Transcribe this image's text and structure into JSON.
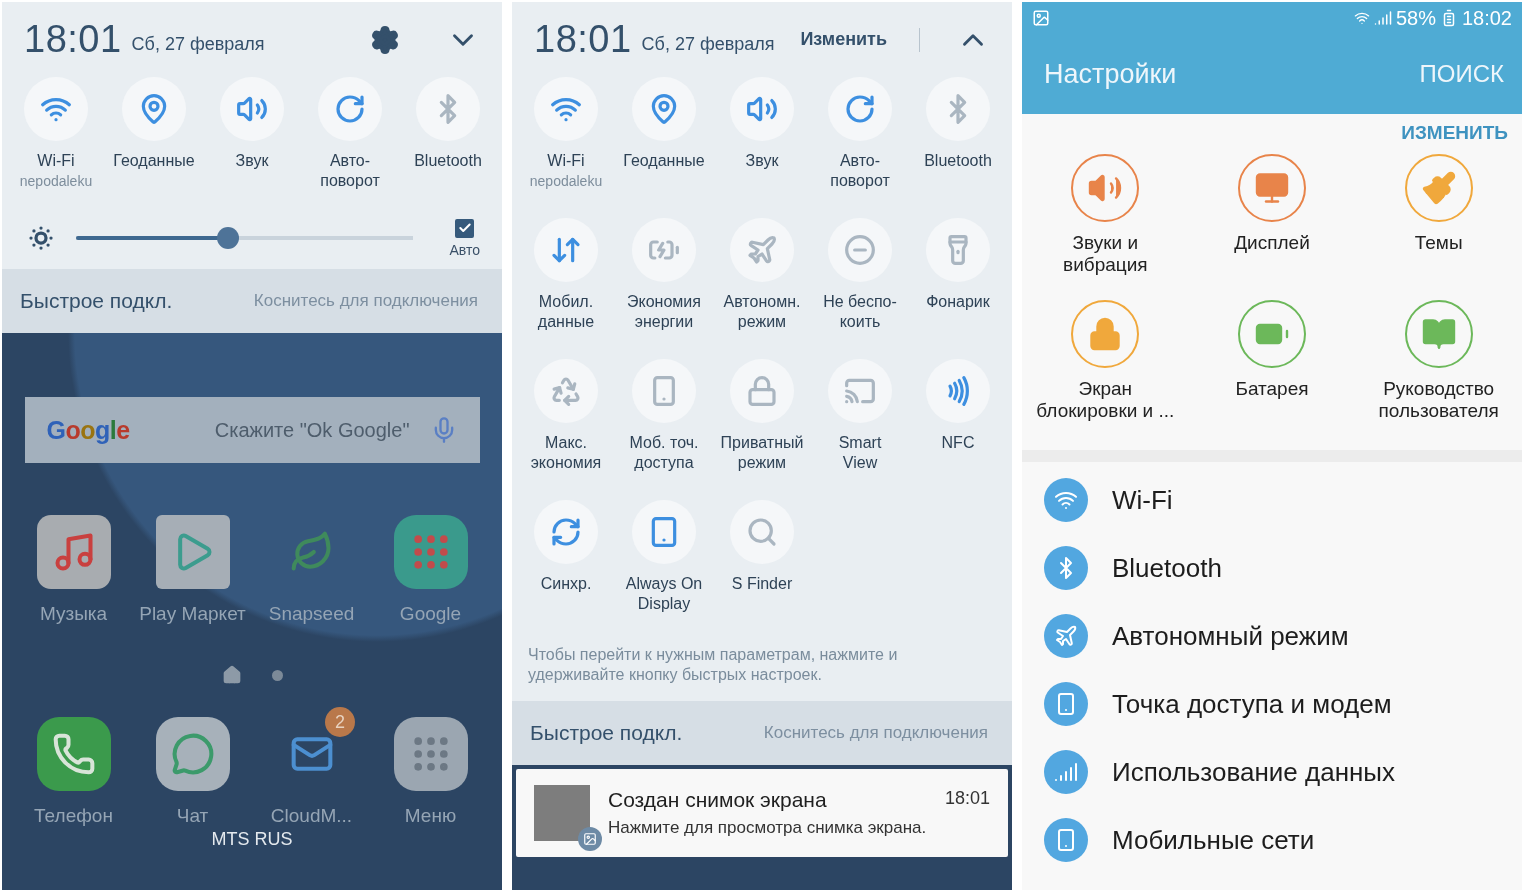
{
  "quick_panel": {
    "time": "18:01",
    "date": "Сб, 27 февраля",
    "tiles": [
      {
        "label": "Wi-Fi",
        "sublabel": "nepodaleku",
        "on": true
      },
      {
        "label": "Геоданные",
        "on": true
      },
      {
        "label": "Звук",
        "on": true
      },
      {
        "label": "Авто-\nповорот",
        "on": true
      },
      {
        "label": "Bluetooth",
        "on": false
      }
    ],
    "brightness": {
      "level": 0.45,
      "auto_label": "Авто",
      "auto_checked": true
    },
    "quick_connect": {
      "title": "Быстрое подкл.",
      "hint": "Коснитесь для подключения"
    },
    "home": {
      "search_logo": "Google",
      "search_placeholder": "Скажите \"Ok Google\"",
      "apps": [
        {
          "label": "Музыка"
        },
        {
          "label": "Play Маркет"
        },
        {
          "label": "Snapseed"
        },
        {
          "label": "Google"
        }
      ],
      "dock": [
        {
          "label": "Телефон"
        },
        {
          "label": "Чат"
        },
        {
          "label": "CloudM...",
          "badge": "2"
        },
        {
          "label": "Меню"
        }
      ],
      "carrier": "MTS RUS"
    }
  },
  "expanded_panel": {
    "time": "18:01",
    "date": "Сб, 27 февраля",
    "edit_label": "Изменить",
    "tiles": [
      {
        "label": "Wi-Fi",
        "sublabel": "nepodaleku",
        "on": true
      },
      {
        "label": "Геоданные",
        "on": true
      },
      {
        "label": "Звук",
        "on": true
      },
      {
        "label": "Авто-\nповорот",
        "on": true
      },
      {
        "label": "Bluetooth",
        "on": false
      },
      {
        "label": "Мобил.\nданные",
        "on": true
      },
      {
        "label": "Экономия\nэнергии",
        "on": false
      },
      {
        "label": "Автономн.\nрежим",
        "on": false
      },
      {
        "label": "Не беспо-\nкоить",
        "on": false
      },
      {
        "label": "Фонарик",
        "on": false
      },
      {
        "label": "Макс.\nэкономия",
        "on": false
      },
      {
        "label": "Моб. точ.\nдоступа",
        "on": false
      },
      {
        "label": "Приватный\nрежим",
        "on": false
      },
      {
        "label": "Smart\nView",
        "on": false
      },
      {
        "label": "NFC",
        "on": true
      },
      {
        "label": "Синхр.",
        "on": true
      },
      {
        "label": "Always On\nDisplay",
        "on": true
      },
      {
        "label": "S Finder",
        "on": false
      }
    ],
    "hint": "Чтобы перейти к нужным параметрам, нажмите и удерживайте кнопку быстрых настроек.",
    "quick_connect": {
      "title": "Быстрое подкл.",
      "hint": "Коснитесь для подключения"
    },
    "notification": {
      "title": "Создан снимок экрана",
      "time": "18:01",
      "text": "Нажмите для просмотра снимка экрана."
    }
  },
  "settings": {
    "status_bar": {
      "battery": "58%",
      "time": "18:02"
    },
    "title": "Настройки",
    "search_label": "ПОИСК",
    "edit_label": "ИЗМЕНИТЬ",
    "shortcuts": [
      {
        "label": "Звуки и\nвибрация",
        "color": "#e8844a"
      },
      {
        "label": "Дисплей",
        "color": "#e8844a"
      },
      {
        "label": "Темы",
        "color": "#f0a83c"
      },
      {
        "label": "Экран\nблокировки и ...",
        "color": "#f0a83c"
      },
      {
        "label": "Батарея",
        "color": "#6cb85a"
      },
      {
        "label": "Руководство\nпользователя",
        "color": "#6cb85a"
      }
    ],
    "items": [
      {
        "label": "Wi-Fi"
      },
      {
        "label": "Bluetooth"
      },
      {
        "label": "Автономный режим"
      },
      {
        "label": "Точка доступа и модем"
      },
      {
        "label": "Использование данных"
      },
      {
        "label": "Мобильные сети"
      }
    ]
  }
}
